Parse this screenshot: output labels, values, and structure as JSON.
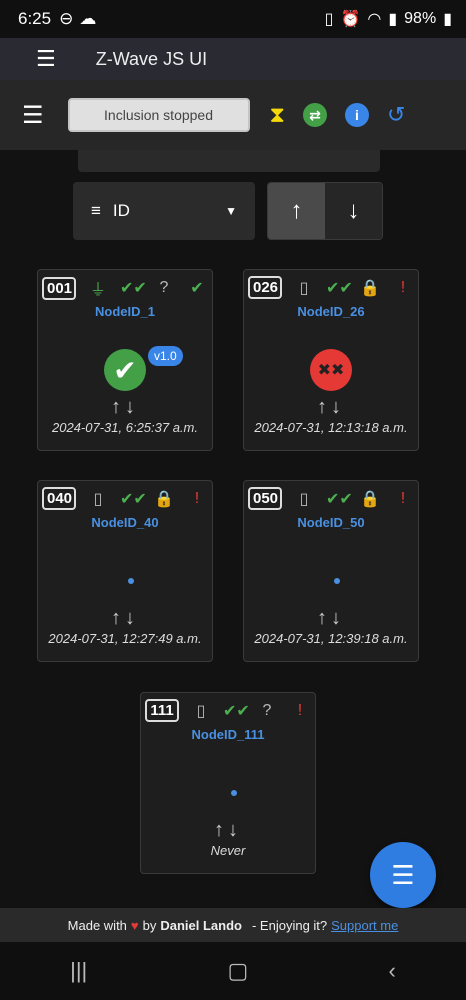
{
  "status": {
    "time": "6:25",
    "battery": "98%"
  },
  "app": {
    "title": "Z-Wave JS UI"
  },
  "toolbar": {
    "inclusion_label": "Inclusion stopped"
  },
  "sort": {
    "field": "ID"
  },
  "nodes": [
    {
      "id": "001",
      "name": "NodeID_1",
      "date": "2024-07-31, 6:25:37 a.m.",
      "version": "v1.0"
    },
    {
      "id": "026",
      "name": "NodeID_26",
      "date": "2024-07-31, 12:13:18 a.m."
    },
    {
      "id": "040",
      "name": "NodeID_40",
      "date": "2024-07-31, 12:27:49 a.m."
    },
    {
      "id": "050",
      "name": "NodeID_50",
      "date": "2024-07-31, 12:39:18 a.m."
    },
    {
      "id": "111",
      "name": "NodeID_111",
      "date": "Never"
    }
  ],
  "footer": {
    "made_with": "Made with",
    "by": "by",
    "author": "Daniel Lando",
    "enjoy": "- Enjoying it?",
    "support": "Support me"
  },
  "colors": {
    "accent": "#2f7de1",
    "ok": "#43a047",
    "error": "#e53935",
    "hourglass": "#f5d90a"
  }
}
